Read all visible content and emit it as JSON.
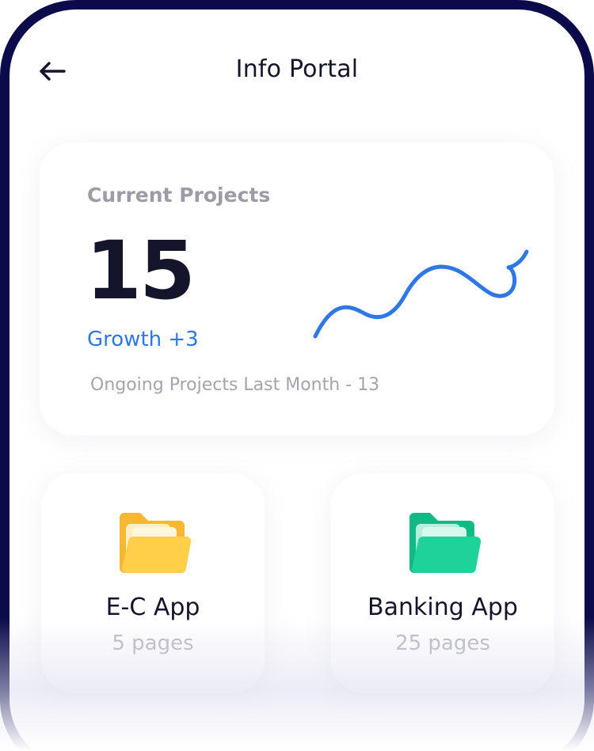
{
  "header": {
    "title": "Info Portal",
    "back_icon": "arrow-left-icon"
  },
  "projects": {
    "label": "Current Projects",
    "count": "15",
    "growth": "Growth +3",
    "last_month": "Ongoing Projects Last Month - 13",
    "trend_icon": "sparkline-trend"
  },
  "folders": [
    {
      "name": "E-C App",
      "pages": "5 pages",
      "icon": "folder-icon",
      "color": "#ffc93c"
    },
    {
      "name": "Banking App",
      "pages": "25 pages",
      "icon": "folder-icon",
      "color": "#1ed39a"
    }
  ],
  "colors": {
    "accent_blue": "#2f76e6",
    "frame": "#0b0a4a",
    "text_dark": "#14142b",
    "text_muted": "#9c9ca6"
  }
}
